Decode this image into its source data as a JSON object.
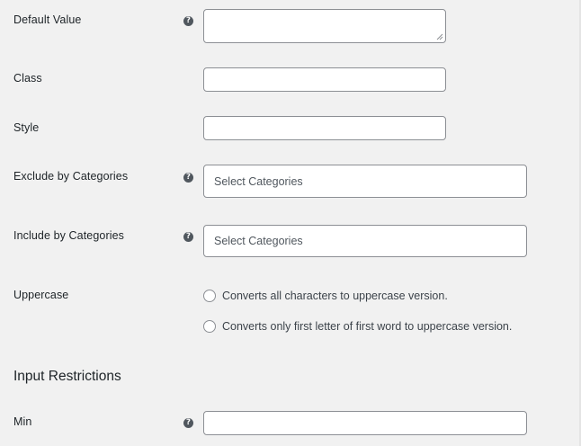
{
  "fields": {
    "default_value": {
      "label": "Default Value",
      "help": "?"
    },
    "class": {
      "label": "Class"
    },
    "style": {
      "label": "Style"
    },
    "exclude_categories": {
      "label": "Exclude by Categories",
      "help": "?",
      "placeholder": "Select Categories"
    },
    "include_categories": {
      "label": "Include by Categories",
      "help": "?",
      "placeholder": "Select Categories"
    },
    "uppercase": {
      "label": "Uppercase",
      "options": [
        "Converts all characters to uppercase version.",
        "Converts only first letter of first word to uppercase version."
      ]
    }
  },
  "input_restrictions": {
    "heading": "Input Restrictions",
    "min": {
      "label": "Min",
      "help": "?"
    }
  }
}
